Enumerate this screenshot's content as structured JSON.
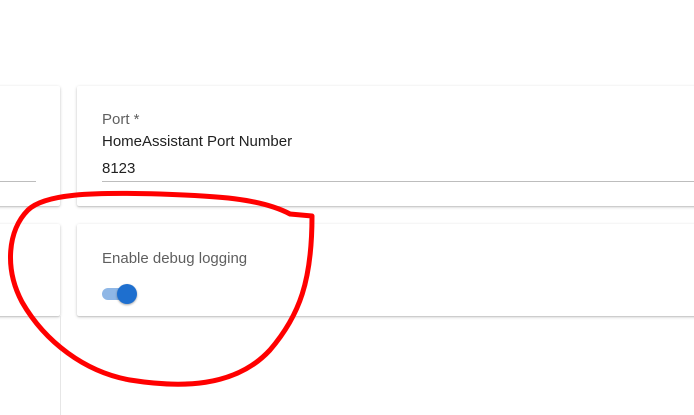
{
  "port_field": {
    "label": "Port *",
    "description": "HomeAssistant Port Number",
    "value": "8123"
  },
  "debug_setting": {
    "label": "Enable debug logging",
    "enabled": true
  },
  "colors": {
    "toggle_on": "#1e6fcf",
    "toggle_track": "#8fb7e6",
    "annotation": "#ff0000"
  }
}
